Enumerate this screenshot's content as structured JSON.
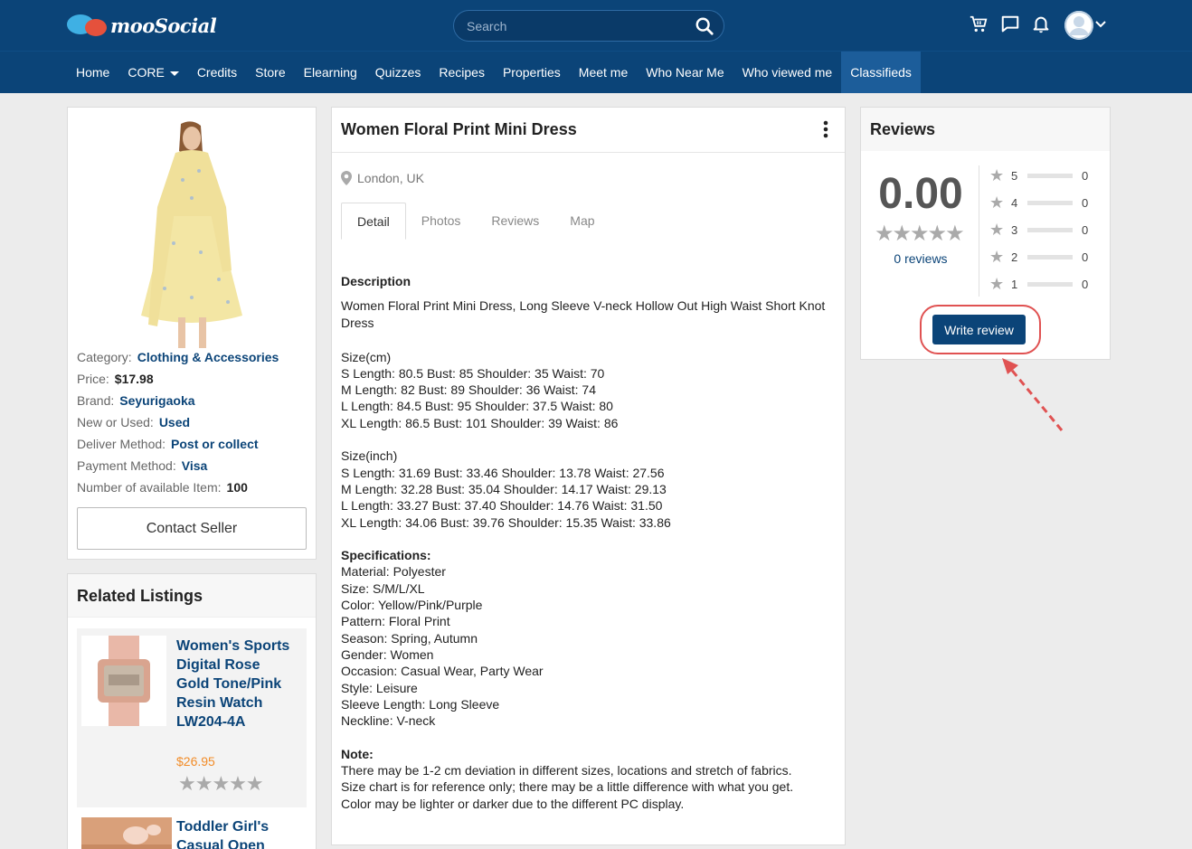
{
  "brand": {
    "logo_text": "mooSocial"
  },
  "search": {
    "placeholder": "Search"
  },
  "nav": {
    "items": [
      "Home",
      "CORE",
      "Credits",
      "Store",
      "Elearning",
      "Quizzes",
      "Recipes",
      "Properties",
      "Meet me",
      "Who Near Me",
      "Who viewed me",
      "Classifieds"
    ],
    "active": "Classifieds"
  },
  "listing": {
    "title": "Women Floral Print Mini Dress",
    "location": "London, UK",
    "tabs": [
      "Detail",
      "Photos",
      "Reviews",
      "Map"
    ],
    "attributes": [
      {
        "label": "Category:",
        "value": "Clothing & Accessories"
      },
      {
        "label": "Price:",
        "value": "$17.98"
      },
      {
        "label": "Brand:",
        "value": "Seyurigaoka"
      },
      {
        "label": "New or Used:",
        "value": "Used"
      },
      {
        "label": "Deliver Method:",
        "value": "Post or collect"
      },
      {
        "label": "Payment Method:",
        "value": "Visa"
      },
      {
        "label": "Number of available Item:",
        "value": "100"
      }
    ],
    "contact_label": "Contact Seller",
    "description": {
      "heading": "Description",
      "intro": "Women Floral Print Mini Dress, Long Sleeve V-neck Hollow Out High Waist Short Knot Dress",
      "size_cm_title": "Size(cm)",
      "size_cm": [
        "S Length: 80.5 Bust: 85 Shoulder: 35 Waist: 70",
        "M Length: 82 Bust: 89 Shoulder: 36 Waist: 74",
        "L Length: 84.5 Bust: 95 Shoulder: 37.5 Waist: 80",
        "XL Length: 86.5 Bust: 101 Shoulder: 39 Waist: 86"
      ],
      "size_inch_title": "Size(inch)",
      "size_inch": [
        "S Length: 31.69 Bust: 33.46 Shoulder: 13.78 Waist: 27.56",
        "M Length: 32.28 Bust: 35.04 Shoulder: 14.17 Waist: 29.13",
        "L Length: 33.27 Bust: 37.40 Shoulder: 14.76 Waist: 31.50",
        "XL Length: 34.06 Bust: 39.76 Shoulder: 15.35 Waist: 33.86"
      ],
      "spec_title": "Specifications:",
      "specs": [
        "Material: Polyester",
        "Size: S/M/L/XL",
        "Color: Yellow/Pink/Purple",
        "Pattern: Floral Print",
        "Season: Spring, Autumn",
        "Gender: Women",
        "Occasion: Casual Wear, Party Wear",
        "Style: Leisure",
        "Sleeve Length: Long Sleeve",
        "Neckline: V-neck"
      ],
      "note_title": "Note:",
      "notes": [
        "There may be 1-2 cm deviation in different sizes, locations and stretch of fabrics.",
        "Size chart is for reference only; there may be a little difference with what you get.",
        "Color may be lighter or darker due to the different PC display."
      ]
    }
  },
  "related": {
    "title": "Related Listings",
    "items": [
      {
        "name": "Women's Sports Digital Rose Gold Tone/Pink Resin Watch LW204-4A",
        "price": "$26.95",
        "rating": 0
      },
      {
        "name": "Toddler Girl's Casual Open"
      }
    ]
  },
  "reviews": {
    "title": "Reviews",
    "score": "0.00",
    "count_label": "0 reviews",
    "breakdown": [
      {
        "stars": "5",
        "count": "0"
      },
      {
        "stars": "4",
        "count": "0"
      },
      {
        "stars": "3",
        "count": "0"
      },
      {
        "stars": "2",
        "count": "0"
      },
      {
        "stars": "1",
        "count": "0"
      }
    ],
    "write_label": "Write review"
  },
  "colors": {
    "primary": "#0b4478",
    "accent": "#e05252",
    "price": "#f28c28"
  }
}
